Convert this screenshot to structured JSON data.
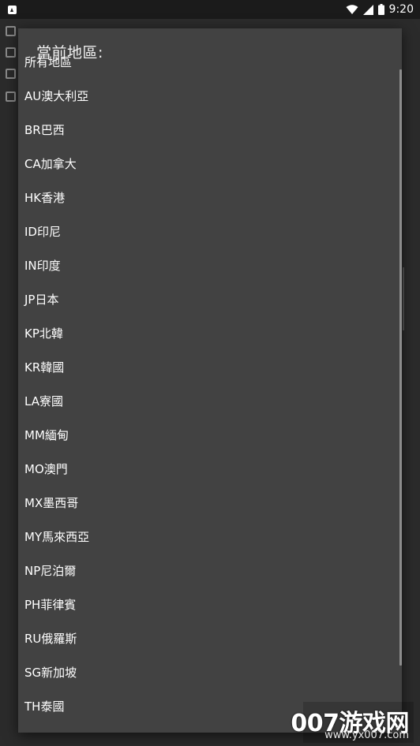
{
  "status_bar": {
    "time": "9:20",
    "icons": [
      "app-notification-icon",
      "wifi-icon",
      "signal-icon",
      "battery-icon"
    ]
  },
  "dialog": {
    "title": "當前地區:",
    "items": [
      "所有地區",
      "AU澳大利亞",
      "BR巴西",
      "CA加拿大",
      "HK香港",
      "ID印尼",
      "IN印度",
      "JP日本",
      "KP北韓",
      "KR韓國",
      "LA寮國",
      "MM緬甸",
      "MO澳門",
      "MX墨西哥",
      "MY馬來西亞",
      "NP尼泊爾",
      "PH菲律賓",
      "RU俄羅斯",
      "SG新加坡",
      "TH泰國"
    ]
  },
  "watermark": {
    "main": "007游戏网",
    "url": "www.yx007.com"
  }
}
